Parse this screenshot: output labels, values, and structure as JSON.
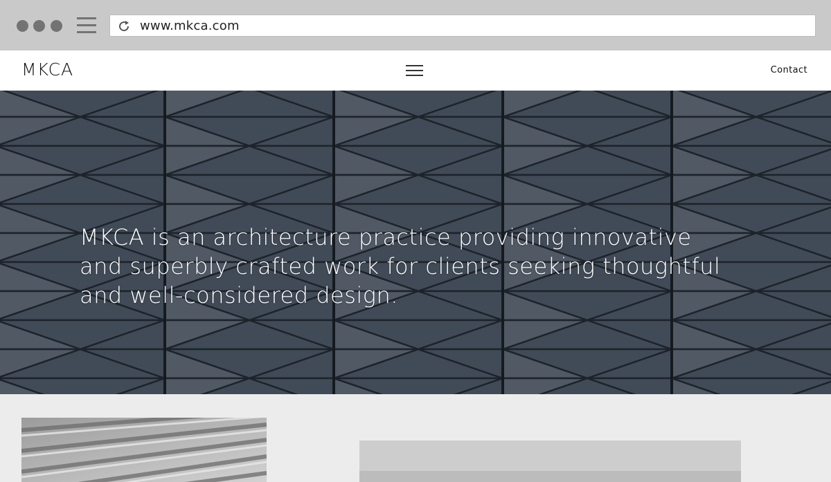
{
  "browser": {
    "url": "www.mkca.com",
    "icons": [
      "window-dot-icon",
      "menu-icon",
      "reload-icon"
    ]
  },
  "site": {
    "logo": "MKCA",
    "menu_icon": "hamburger-icon",
    "contact_label": "Contact"
  },
  "hero": {
    "text": "MKCA is an architecture practice providing innovative and superbly crafted work for clients seeking thoughtful and well-considered design."
  },
  "colors": {
    "chrome": "#c9c9c9",
    "hero_tiles": "#4a5663",
    "page_background": "#ececec"
  }
}
